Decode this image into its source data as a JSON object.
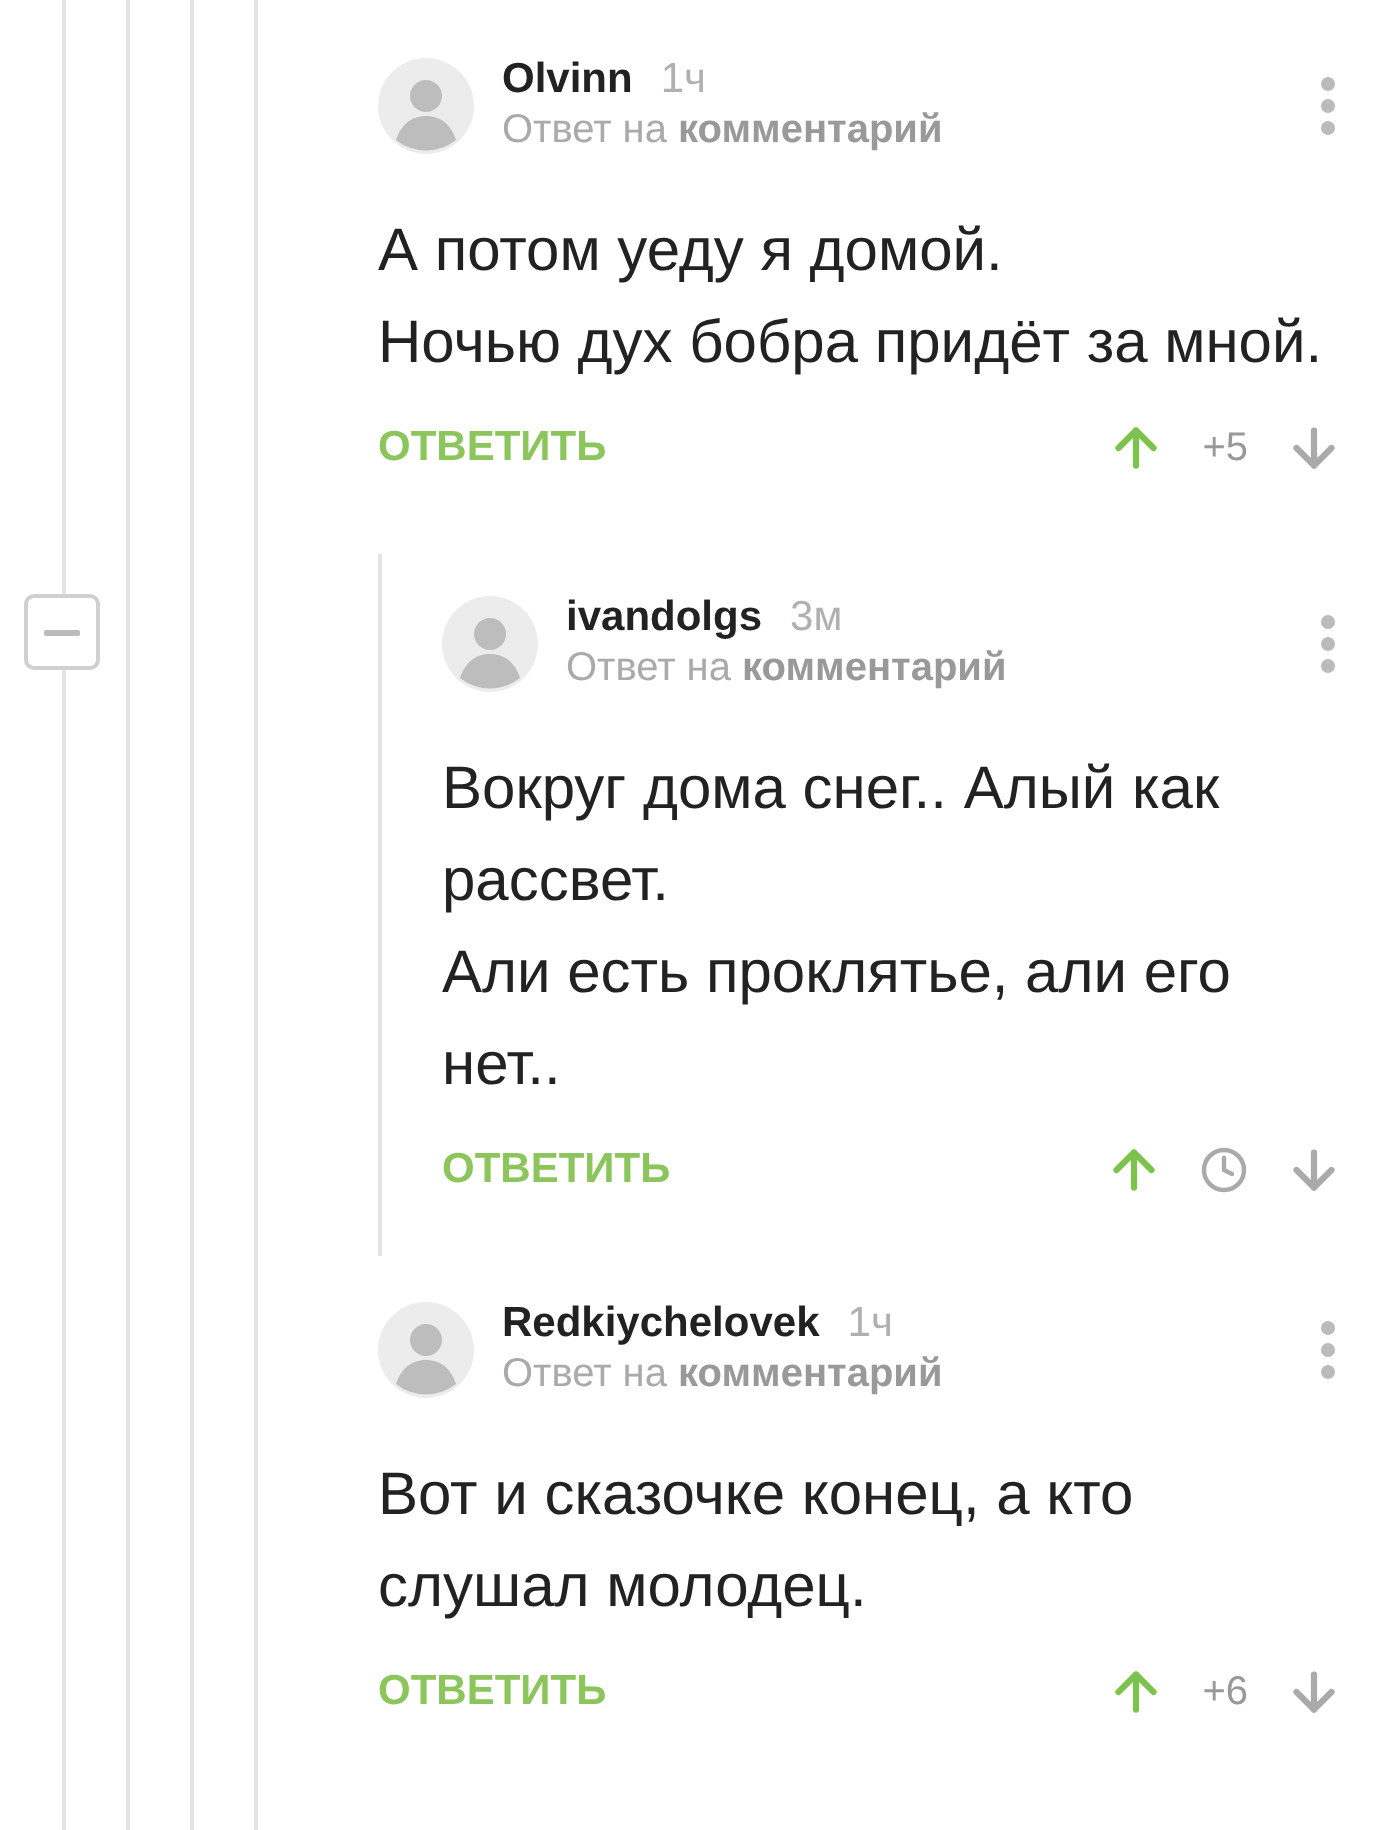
{
  "comments": [
    {
      "author": "Olvinn",
      "time": "1ч",
      "reply_to": "Ответ на **комментарий**",
      "lines": [
        "А потом уеду я домой.",
        "Ночью дух бобра придёт за мной."
      ],
      "reply_button": "ОТВЕТИТЬ",
      "rating_hidden": false,
      "rating": "+5",
      "nested": false
    },
    {
      "author": "ivandolgs",
      "time": "3м",
      "reply_to": "Ответ на **комментарий**",
      "lines": [
        "Вокруг дома снег.. Алый как рассвет.",
        "Али есть проклятье, али его нет.."
      ],
      "reply_button": "ОТВЕТИТЬ",
      "rating_hidden": true,
      "nested": true
    },
    {
      "author": "Redkiychelovek",
      "time": "1ч",
      "reply_to": "Ответ на **комментарий**",
      "lines": [
        "Вот и сказочке конец, а кто слушал молодец."
      ],
      "reply_button": "ОТВЕТИТЬ",
      "rating_hidden": false,
      "rating": "+6",
      "nested": false
    }
  ]
}
